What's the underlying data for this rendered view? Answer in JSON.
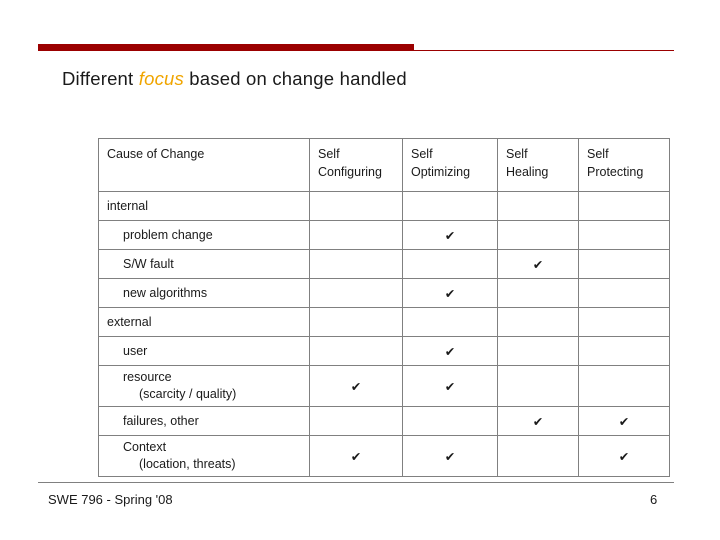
{
  "slide": {
    "title_prefix": "Different ",
    "title_keyword": "focus",
    "title_suffix": " based on change handled",
    "accent_color": "#9b0000",
    "keyword_color": "#f0a500",
    "section_color": "#9b26b6",
    "check_glyph": "✔"
  },
  "table": {
    "columns": [
      {
        "label": "Cause of Change",
        "line2": ""
      },
      {
        "label": "Self",
        "line2": "Configuring"
      },
      {
        "label": "Self",
        "line2": "Optimizing"
      },
      {
        "label": "Self",
        "line2": "Healing"
      },
      {
        "label": "Self",
        "line2": "Protecting"
      }
    ],
    "rows": [
      {
        "kind": "section",
        "label": "internal",
        "checks": [
          false,
          false,
          false,
          false
        ]
      },
      {
        "kind": "item",
        "label": "problem change",
        "line2": "",
        "checks": [
          false,
          true,
          false,
          false
        ]
      },
      {
        "kind": "item",
        "label": "S/W fault",
        "line2": "",
        "checks": [
          false,
          false,
          true,
          false
        ]
      },
      {
        "kind": "item",
        "label": "new algorithms",
        "line2": "",
        "checks": [
          false,
          true,
          false,
          false
        ]
      },
      {
        "kind": "section",
        "label": "external",
        "checks": [
          false,
          false,
          false,
          false
        ]
      },
      {
        "kind": "item",
        "label": "user",
        "line2": "",
        "checks": [
          false,
          true,
          false,
          false
        ]
      },
      {
        "kind": "item",
        "label": "resource",
        "line2": "(scarcity / quality)",
        "checks": [
          true,
          true,
          false,
          false
        ]
      },
      {
        "kind": "item",
        "label": "failures, other",
        "line2": "",
        "checks": [
          false,
          false,
          true,
          true
        ]
      },
      {
        "kind": "item",
        "label": "Context",
        "line2": "(location, threats)",
        "checks": [
          true,
          true,
          false,
          true
        ]
      }
    ]
  },
  "footer": {
    "course": "SWE 796 - Spring '08",
    "page_number": "6"
  }
}
